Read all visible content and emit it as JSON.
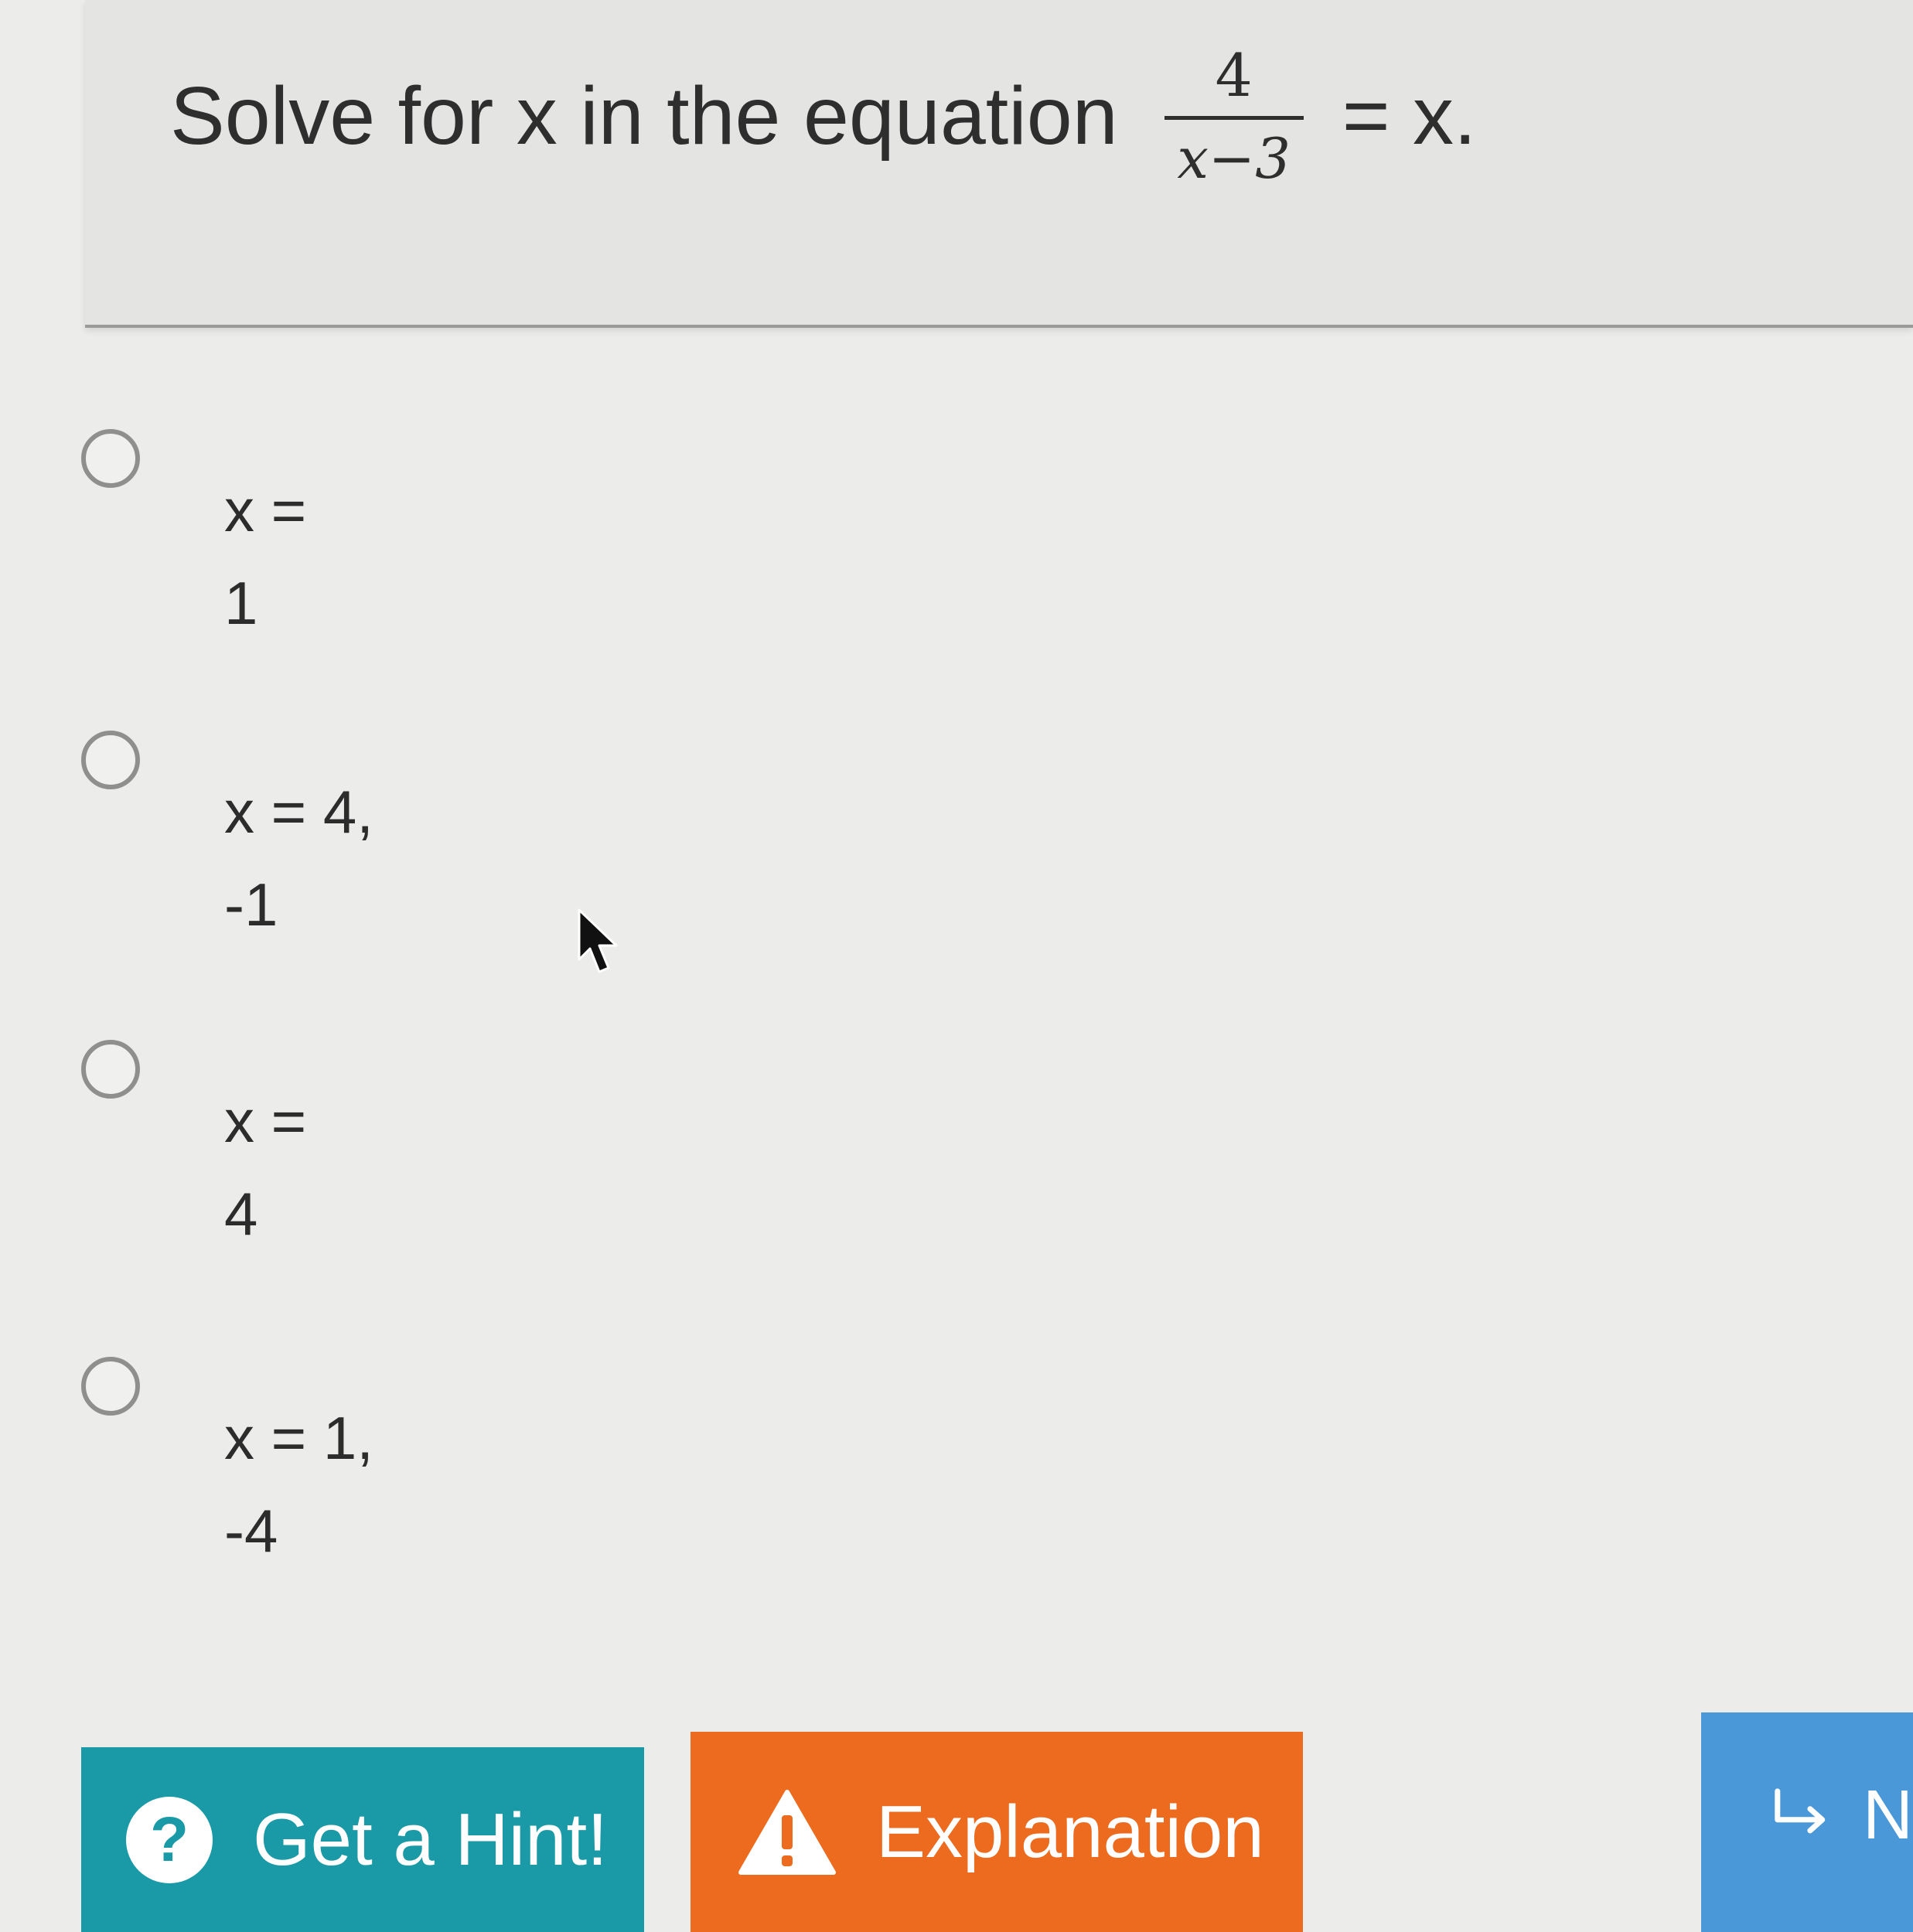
{
  "question": {
    "prefix": "Solve for x in the equation",
    "fraction_numerator": "4",
    "fraction_denominator": "x−3",
    "suffix": "= x."
  },
  "options": [
    {
      "line1": "x =",
      "line2": "1"
    },
    {
      "line1": "x = 4,",
      "line2": "-1"
    },
    {
      "line1": "x =",
      "line2": "4"
    },
    {
      "line1": "x = 1,",
      "line2": "-4"
    }
  ],
  "buttons": {
    "hint_icon": "?",
    "hint_label": "Get a Hint!",
    "explanation_label": "Explanation",
    "next_label": "N"
  },
  "icons": {
    "hint": "question-circle-icon",
    "explanation": "warning-triangle-icon",
    "next": "return-arrow-icon",
    "cursor": "mouse-pointer-icon"
  },
  "colors": {
    "hint_button": "#1a9aa6",
    "explanation_button": "#ec6b1f",
    "next_button": "#4a98d8"
  }
}
